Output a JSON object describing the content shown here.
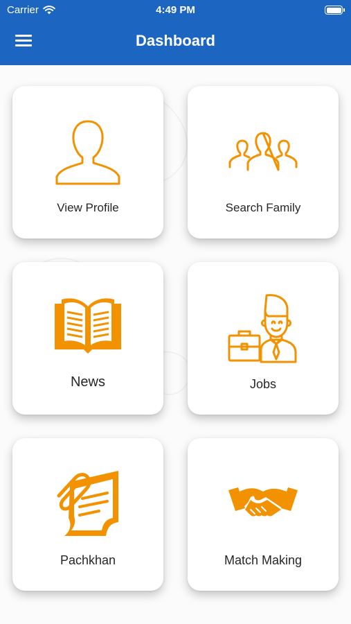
{
  "status_bar": {
    "carrier": "Carrier",
    "time": "4:49 PM"
  },
  "header": {
    "title": "Dashboard"
  },
  "colors": {
    "header": "#1c66c1",
    "icon": "#f39200",
    "card": "#ffffff"
  },
  "tiles": [
    {
      "label": "View Profile",
      "icon": "person-outline-icon"
    },
    {
      "label": "Search Family",
      "icon": "group-outline-icon"
    },
    {
      "label": "News",
      "icon": "open-book-icon"
    },
    {
      "label": "Jobs",
      "icon": "businessman-briefcase-icon"
    },
    {
      "label": "Pachkhan",
      "icon": "document-clip-icon"
    },
    {
      "label": "Match Making",
      "icon": "handshake-icon"
    }
  ]
}
